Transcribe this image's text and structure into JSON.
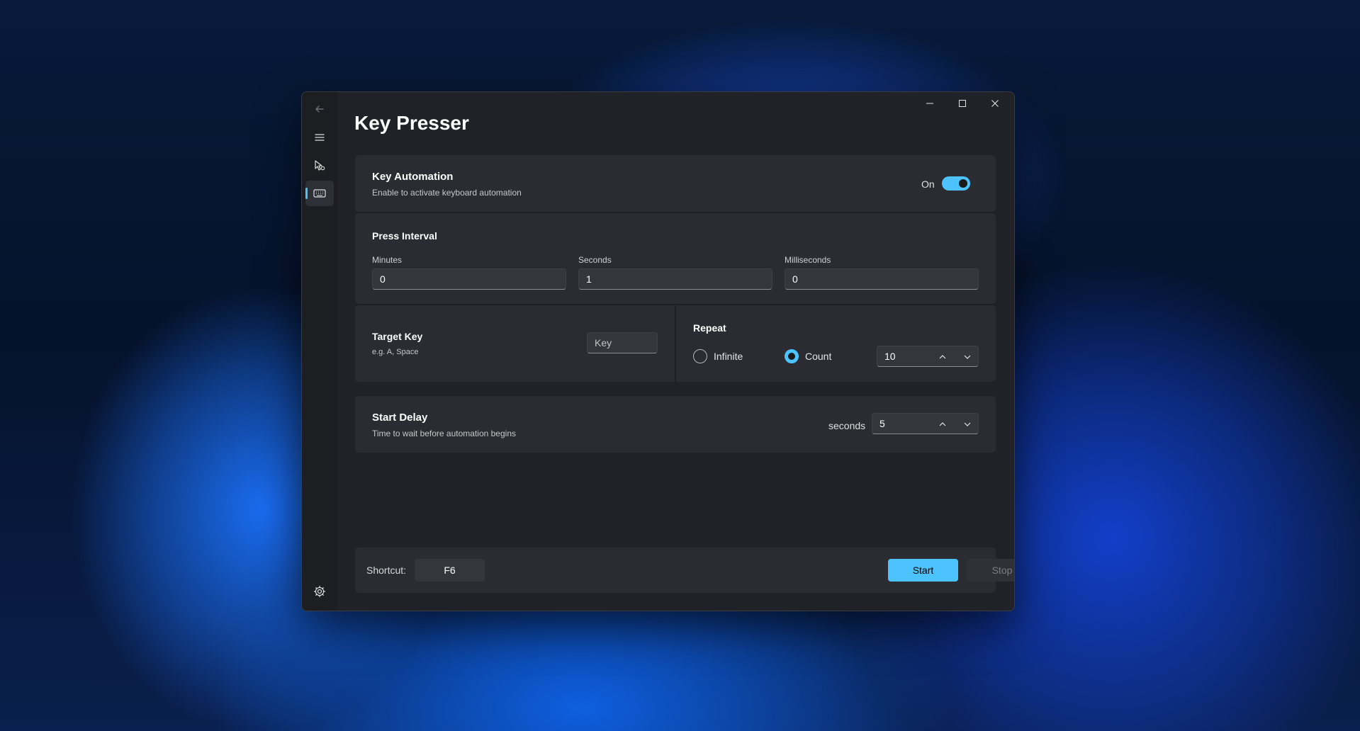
{
  "window": {
    "title": "Key Presser",
    "caption": {
      "minimize_icon": "minimize-icon",
      "maximize_icon": "maximize-icon",
      "close_icon": "close-icon"
    }
  },
  "sidebar": {
    "back_icon": "arrow-left-icon",
    "menu_icon": "hamburger-icon",
    "items": [
      {
        "icon": "mouse-pointer-icon",
        "selected": false
      },
      {
        "icon": "keyboard-icon",
        "selected": true
      }
    ],
    "settings_icon": "gear-icon"
  },
  "key_automation": {
    "title": "Key Automation",
    "subtitle": "Enable to activate keyboard automation",
    "toggle_label": "On",
    "toggle_on": true
  },
  "press_interval": {
    "title": "Press Interval",
    "fields": [
      {
        "label": "Minutes",
        "value": "0"
      },
      {
        "label": "Seconds",
        "value": "1"
      },
      {
        "label": "Milliseconds",
        "value": "0"
      }
    ]
  },
  "target_key": {
    "title": "Target Key",
    "subtitle": "e.g. A, Space",
    "placeholder": "Key"
  },
  "repeat": {
    "title": "Repeat",
    "options": [
      {
        "label": "Infinite",
        "checked": false
      },
      {
        "label": "Count",
        "checked": true
      }
    ],
    "count_value": "10"
  },
  "start_delay": {
    "title": "Start Delay",
    "subtitle": "Time to wait before automation begins",
    "unit_label": "seconds",
    "value": "5"
  },
  "footer": {
    "shortcut_label": "Shortcut:",
    "shortcut_value": "F6",
    "start_label": "Start",
    "stop_label": "Stop"
  },
  "colors": {
    "accent": "#4cc2ff",
    "window_bg": "#202227",
    "card_bg": "#2a2c32"
  }
}
